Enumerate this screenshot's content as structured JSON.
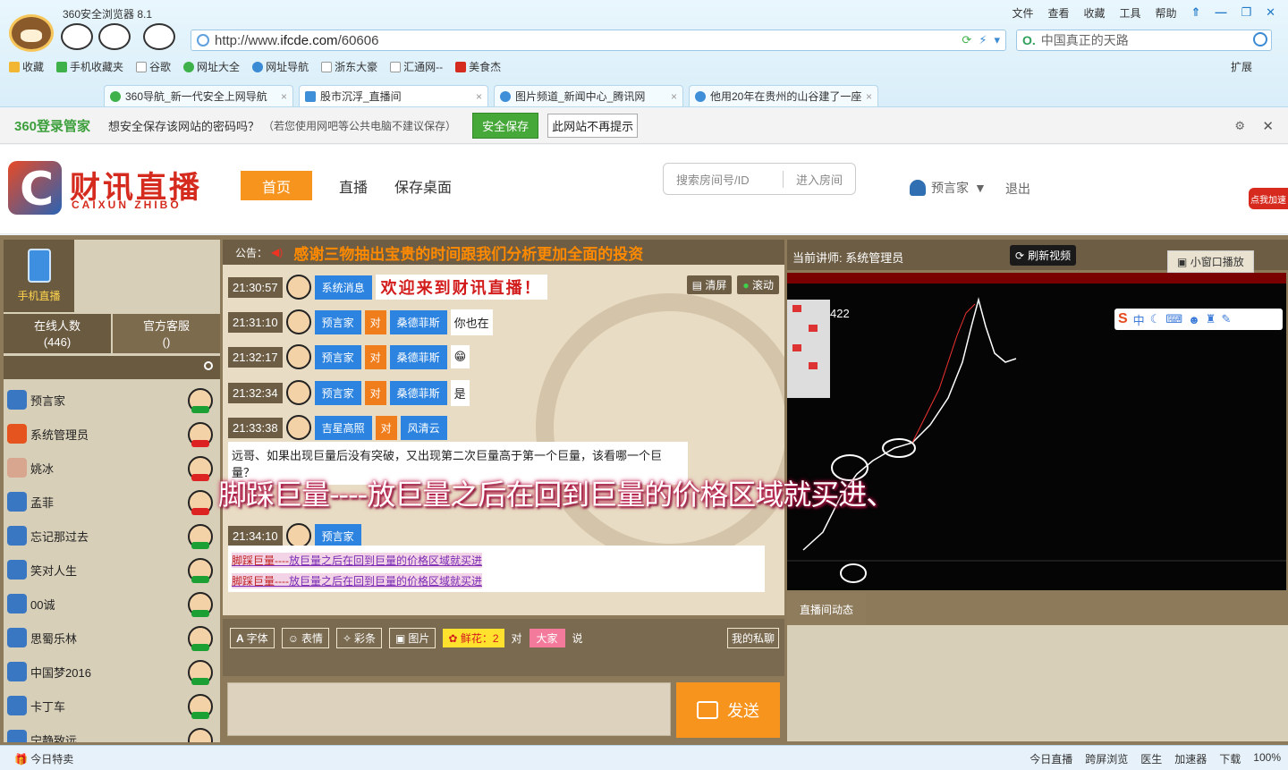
{
  "browser": {
    "title": "360安全浏览器 8.1",
    "menu": [
      "文件",
      "查看",
      "收藏",
      "工具",
      "帮助"
    ],
    "url_prefix": "http://www.",
    "url_host": "ifcde.com",
    "url_path": "/60606",
    "search_text": "中国真正的天路",
    "bookmarks": [
      "收藏",
      "手机收藏夹",
      "谷歌",
      "网址大全",
      "网址导航",
      "浙东大豪",
      "汇通网--",
      "美食杰"
    ],
    "extend_label": "扩展",
    "tabs": [
      "360导航_新一代安全上网导航",
      "股市沉浮_直播间",
      "图片频道_新闻中心_腾讯网",
      "他用20年在贵州的山谷建了一座"
    ],
    "accent_color": "#3a8ad4"
  },
  "password_bar": {
    "brand": "360登录管家",
    "message": "想安全保存该网站的密码吗？",
    "note": "（若您使用网吧等公共电脑不建议保存）",
    "save_label": "安全保存",
    "no_hint_label": "此网站不再提示"
  },
  "site": {
    "name": "财讯直播",
    "sub": "CAIXUN ZHIBO",
    "nav": [
      "首页",
      "直播",
      "保存桌面"
    ],
    "room_search_placeholder": "搜索房间号/ID",
    "enter_room": "进入房间",
    "user": "预言家",
    "logout": "退出",
    "float_label": "点我加速",
    "brand_color": "#d52b1e",
    "nav_active_color": "#f7941d"
  },
  "left": {
    "mobile_live": "手机直播",
    "online_label": "在线人数",
    "online_count": "(446)",
    "service_label": "官方客服",
    "service_count": "()",
    "users": [
      {
        "name": "预言家",
        "badge": "green"
      },
      {
        "name": "系统管理员",
        "badge": "red"
      },
      {
        "name": "姚冰",
        "badge": "red"
      },
      {
        "name": "孟菲",
        "badge": "red"
      },
      {
        "name": "忘记那过去",
        "badge": "green"
      },
      {
        "name": "笑对人生",
        "badge": "green"
      },
      {
        "name": "00诚",
        "badge": "green"
      },
      {
        "name": "思蜀乐林",
        "badge": "green"
      },
      {
        "name": "中国梦2016",
        "badge": "green"
      },
      {
        "name": "卡丁车",
        "badge": "green"
      },
      {
        "name": "宁静致远",
        "badge": "green"
      }
    ]
  },
  "chat": {
    "notice_label": "公告：",
    "notice_text": "感谢三物抽出宝贵的时间跟我们分析更加全面的投资",
    "clear_label": "清屏",
    "scroll_label": "滚动",
    "messages": [
      {
        "time": "21:30:57",
        "from": "系统消息",
        "to": "",
        "target": "",
        "text": "欢迎来到财讯直播！"
      },
      {
        "time": "21:31:10",
        "from": "预言家",
        "to": "对",
        "target": "桑德菲斯",
        "text": "你也在"
      },
      {
        "time": "21:32:17",
        "from": "预言家",
        "to": "对",
        "target": "桑德菲斯",
        "text": "😁"
      },
      {
        "time": "21:32:34",
        "from": "预言家",
        "to": "对",
        "target": "桑德菲斯",
        "text": "是"
      },
      {
        "time": "21:33:38",
        "from": "吉星高照",
        "to": "对",
        "target": "风清云",
        "text": ""
      },
      {
        "time": "21:34:10",
        "from": "预言家",
        "to": "",
        "target": "",
        "text": ""
      }
    ],
    "question": "远哥、如果出现巨量后没有突破，又出现第二次巨量高于第一个巨量，该看哪一个巨量？",
    "hidden_line": "远哥...",
    "reply_prefix": "脚踩巨量----",
    "reply_body": "放巨量之后在回到巨量的价格区域就买进",
    "toolbar": {
      "font": "字体",
      "emoji": "表情",
      "color": "彩条",
      "image": "图片",
      "flower": "鲜花：2",
      "to_word": "对",
      "to_all": "大家",
      "say": "说",
      "private": "我的私聊"
    },
    "send_label": "发送"
  },
  "video": {
    "lecturer": "当前讲师: 系统管理员",
    "refresh_label": "刷新视频",
    "mini_label": "小窗口播放",
    "counter": "422",
    "ime_label": "中",
    "dyn_tab": "直播间动态"
  },
  "subtitle": "脚踩巨量----放巨量之后在回到巨量的价格区域就买进、",
  "status": {
    "left": "今日特卖",
    "right": [
      "今日直播",
      "跨屏浏览",
      "医生",
      "加速器",
      "下载",
      "100%"
    ]
  }
}
